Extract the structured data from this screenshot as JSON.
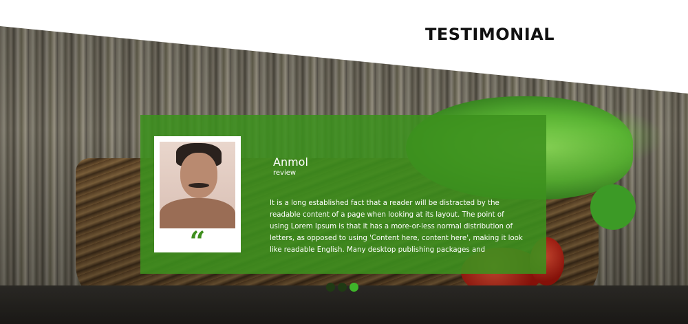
{
  "section": {
    "title": "TESTIMONIAL"
  },
  "testimonial": {
    "name": "Anmol",
    "role": "review",
    "quote_icon": "quote-icon",
    "quote_glyph": "“",
    "text": "It is a long established fact that a reader will be distracted by the readable content of a page when looking at its layout. The point of using Lorem Ipsum is that it has a more-or-less normal distribution of letters, as opposed to using 'Content here, content here', making it look like readable English. Many desktop publishing packages and"
  },
  "carousel": {
    "slide_count": 3,
    "active_index": 2
  },
  "colors": {
    "card_green": "#3c911e",
    "accent_green": "#3fb52a",
    "title_black": "#111111"
  }
}
